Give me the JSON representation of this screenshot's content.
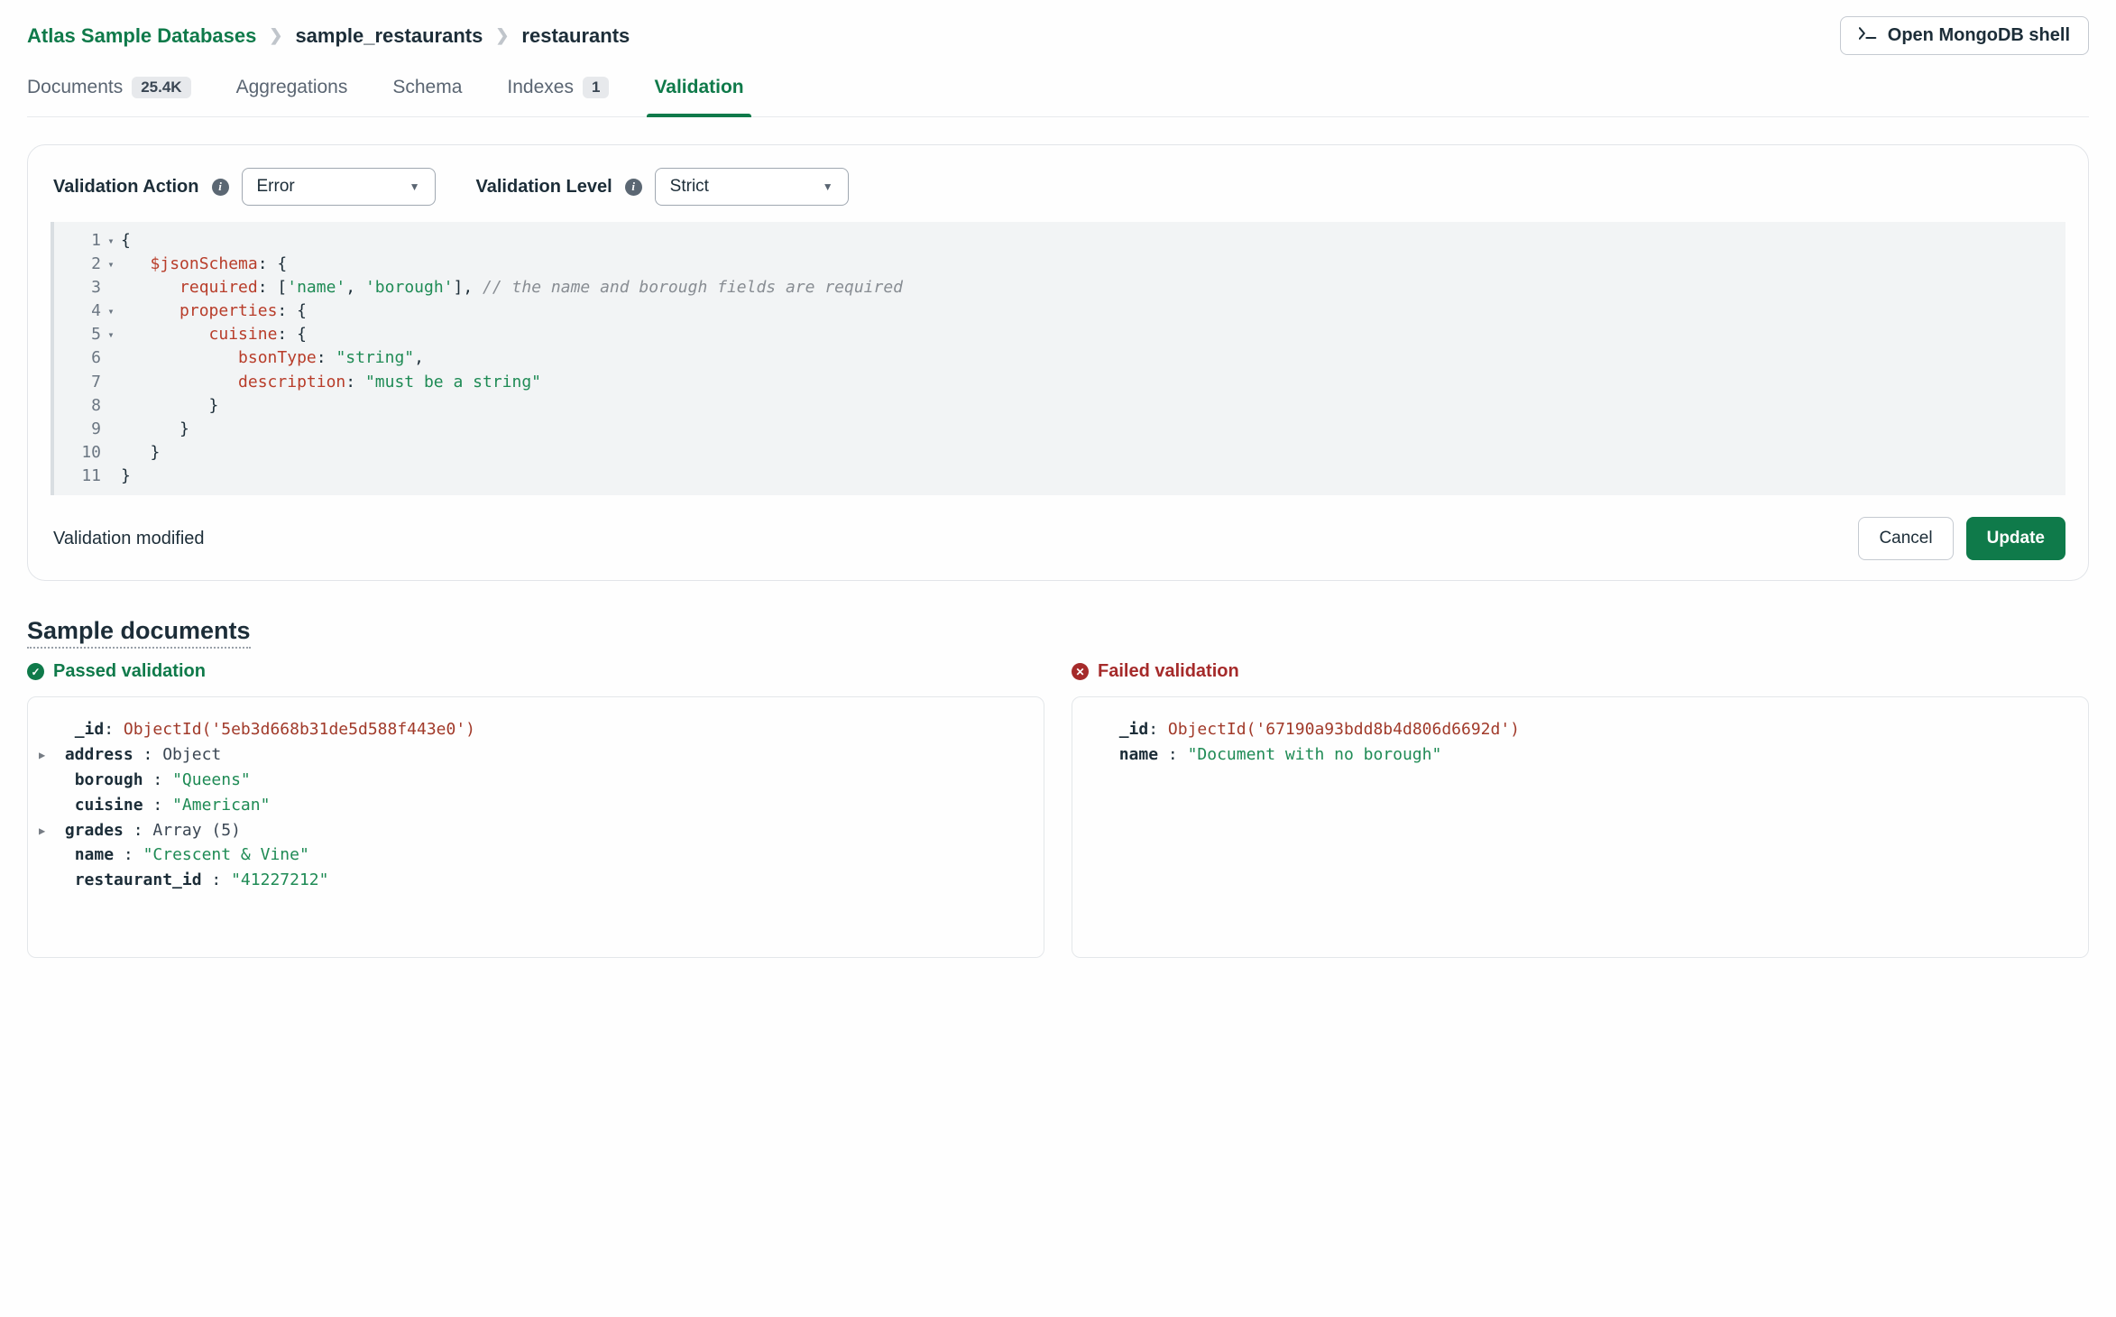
{
  "breadcrumb": {
    "root": "Atlas Sample Databases",
    "db": "sample_restaurants",
    "coll": "restaurants"
  },
  "shell_button": "Open MongoDB shell",
  "tabs": {
    "documents": "Documents",
    "documents_badge": "25.4K",
    "aggregations": "Aggregations",
    "schema": "Schema",
    "indexes": "Indexes",
    "indexes_badge": "1",
    "validation": "Validation"
  },
  "validation": {
    "action_label": "Validation Action",
    "action_value": "Error",
    "level_label": "Validation Level",
    "level_value": "Strict",
    "modified_msg": "Validation modified",
    "cancel": "Cancel",
    "update": "Update"
  },
  "code": {
    "l1_open": "{",
    "l2_key": "$jsonSchema",
    "l2_rest": ": {",
    "l3_key": "required",
    "l3_mid": ": [",
    "l3_s1": "'name'",
    "l3_c": ", ",
    "l3_s2": "'borough'",
    "l3_end": "], ",
    "l3_comment": "// the name and borough fields are required",
    "l4_key": "properties",
    "l4_rest": ": {",
    "l5_key": "cuisine",
    "l5_rest": ": {",
    "l6_key": "bsonType",
    "l6_mid": ": ",
    "l6_val": "\"string\"",
    "l6_end": ",",
    "l7_key": "description",
    "l7_mid": ": ",
    "l7_val": "\"must be a string\"",
    "l8": "}",
    "l9": "}",
    "l10": "}",
    "l11": "}"
  },
  "samples": {
    "title": "Sample documents",
    "pass_label": "Passed validation",
    "fail_label": "Failed validation",
    "pass": {
      "id_key": "_id",
      "id_val": "ObjectId('5eb3d668b31de5d588f443e0')",
      "addr_key": "address",
      "addr_val": "Object",
      "borough_key": "borough",
      "borough_val": "\"Queens\"",
      "cuisine_key": "cuisine",
      "cuisine_val": "\"American\"",
      "grades_key": "grades",
      "grades_val": "Array (5)",
      "name_key": "name",
      "name_val": "\"Crescent & Vine\"",
      "rid_key": "restaurant_id",
      "rid_val": "\"41227212\""
    },
    "fail": {
      "id_key": "_id",
      "id_val": "ObjectId('67190a93bdd8b4d806d6692d')",
      "name_key": "name",
      "name_val": "\"Document with no borough\""
    }
  }
}
